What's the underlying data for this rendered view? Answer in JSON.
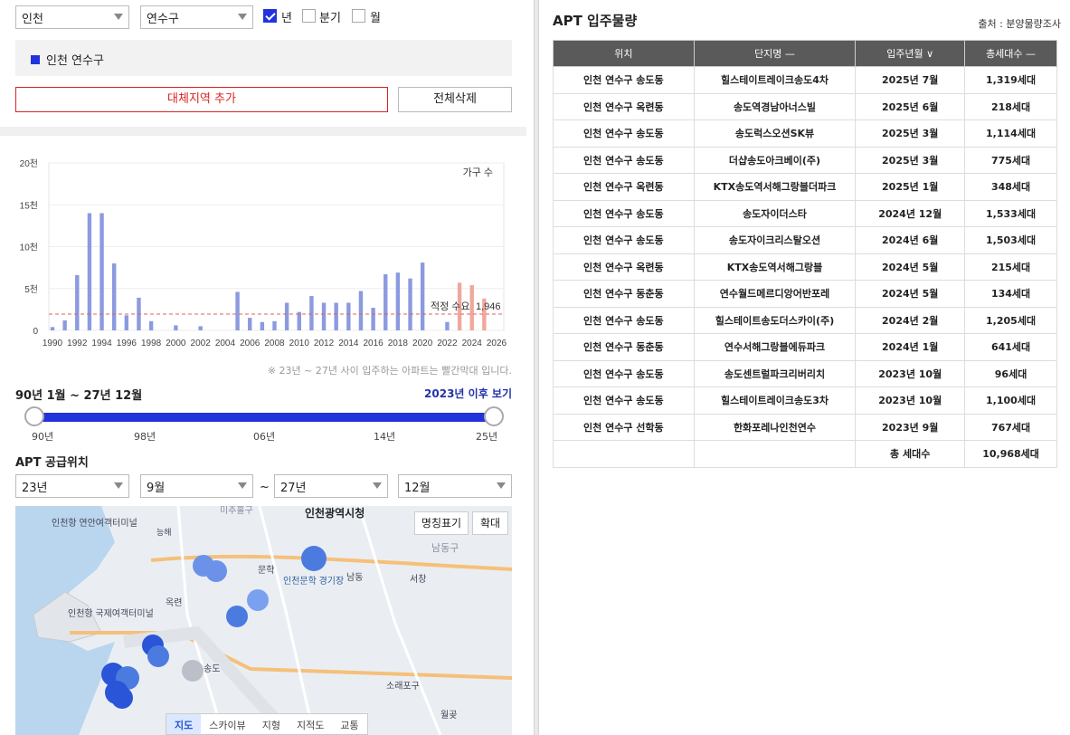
{
  "filters": {
    "region": "인천",
    "district": "연수구",
    "period_options": [
      {
        "label": "년",
        "checked": true
      },
      {
        "label": "분기",
        "checked": false
      },
      {
        "label": "월",
        "checked": false
      }
    ]
  },
  "selected_region": "인천 연수구",
  "buttons": {
    "add_region": "대체지역 추가",
    "delete_all": "전체삭제"
  },
  "chart_data": {
    "type": "bar",
    "legend_label": "가구 수",
    "y_ticks": [
      "20천",
      "15천",
      "10천",
      "5천",
      "0"
    ],
    "ylim": [
      0,
      20000
    ],
    "x_tick_labels": [
      "1990",
      "1992",
      "1994",
      "1996",
      "1998",
      "2000",
      "2002",
      "2004",
      "2006",
      "2008",
      "2010",
      "2012",
      "2014",
      "2016",
      "2018",
      "2020",
      "2022",
      "2024",
      "2026"
    ],
    "x": [
      1990,
      1991,
      1992,
      1993,
      1994,
      1995,
      1996,
      1997,
      1998,
      1999,
      2000,
      2001,
      2002,
      2003,
      2004,
      2005,
      2006,
      2007,
      2008,
      2009,
      2010,
      2011,
      2012,
      2013,
      2014,
      2015,
      2016,
      2017,
      2018,
      2019,
      2020,
      2021,
      2022,
      2023,
      2024,
      2025,
      2026
    ],
    "values": [
      400,
      1200,
      6600,
      14000,
      14000,
      8000,
      1800,
      3900,
      1100,
      0,
      600,
      0,
      500,
      0,
      0,
      4600,
      1500,
      1000,
      1100,
      3300,
      2200,
      4100,
      3300,
      3300,
      3300,
      4700,
      2700,
      6700,
      6900,
      6200,
      8100,
      0,
      1000,
      5700,
      5400,
      3800,
      0
    ],
    "highlight_range": [
      2023,
      2027
    ],
    "base_color": "#8c9ae0",
    "highlight_color": "#f0a89c",
    "reference_line": {
      "label": "적정 수요",
      "value": 1946,
      "value_label": "1,946",
      "color": "#e06060"
    }
  },
  "chart_note": "※ 23년 ~ 27년 사이 입주하는 아파트는 빨간막대 입니다.",
  "range": {
    "label": "90년 1월 ~ 27년 12월",
    "since_link": "2023년 이후 보기",
    "start": 0.0,
    "end": 1.0,
    "tick_labels": [
      "90년",
      "98년",
      "06년",
      "14년",
      "25년"
    ]
  },
  "supply": {
    "title": "APT 공급위치",
    "from_year": "23년",
    "from_month": "9월",
    "tilde": "~",
    "to_year": "27년",
    "to_month": "12월"
  },
  "map": {
    "labels": [
      "인천광역시청",
      "인천항 연안여객터미널",
      "인천항 국제여객터미널",
      "문학",
      "인천문학 경기장",
      "남동구",
      "남동",
      "서창",
      "옥련",
      "송도",
      "소래포구",
      "월곶",
      "미추홀구",
      "능해"
    ],
    "name_toggle": "명칭표기",
    "zoom": "확대",
    "tabs": [
      {
        "label": "지도",
        "active": true
      },
      {
        "label": "스카이뷰",
        "active": false
      },
      {
        "label": "지형",
        "active": false
      },
      {
        "label": "지적도",
        "active": false
      },
      {
        "label": "교통",
        "active": false
      }
    ]
  },
  "right": {
    "title": "APT 입주물량",
    "source": "출처 : 분양물량조사",
    "headers": [
      "위치",
      "단지명 —",
      "입주년월 ∨",
      "총세대수 —"
    ],
    "rows": [
      [
        "인천 연수구 송도동",
        "힐스테이트레이크송도4차",
        "2025년 7월",
        "1,319세대"
      ],
      [
        "인천 연수구 옥련동",
        "송도역경남아너스빌",
        "2025년 6월",
        "218세대"
      ],
      [
        "인천 연수구 송도동",
        "송도럭스오션SK뷰",
        "2025년 3월",
        "1,114세대"
      ],
      [
        "인천 연수구 송도동",
        "더샵송도아크베이(주)",
        "2025년 3월",
        "775세대"
      ],
      [
        "인천 연수구 옥련동",
        "KTX송도역서해그랑블더파크",
        "2025년 1월",
        "348세대"
      ],
      [
        "인천 연수구 송도동",
        "송도자이더스타",
        "2024년 12월",
        "1,533세대"
      ],
      [
        "인천 연수구 송도동",
        "송도자이크리스탈오션",
        "2024년 6월",
        "1,503세대"
      ],
      [
        "인천 연수구 옥련동",
        "KTX송도역서해그랑블",
        "2024년 5월",
        "215세대"
      ],
      [
        "인천 연수구 동춘동",
        "연수월드메르디앙어반포레",
        "2024년 5월",
        "134세대"
      ],
      [
        "인천 연수구 송도동",
        "힐스테이트송도더스카이(주)",
        "2024년 2월",
        "1,205세대"
      ],
      [
        "인천 연수구 동춘동",
        "연수서해그랑블에듀파크",
        "2024년 1월",
        "641세대"
      ],
      [
        "인천 연수구 송도동",
        "송도센트럴파크리버리치",
        "2023년 10월",
        "96세대"
      ],
      [
        "인천 연수구 송도동",
        "힐스테이트레이크송도3차",
        "2023년 10월",
        "1,100세대"
      ],
      [
        "인천 연수구 선학동",
        "한화포레나인천연수",
        "2023년 9월",
        "767세대"
      ]
    ],
    "total_label": "총 세대수",
    "total_value": "10,968세대"
  }
}
